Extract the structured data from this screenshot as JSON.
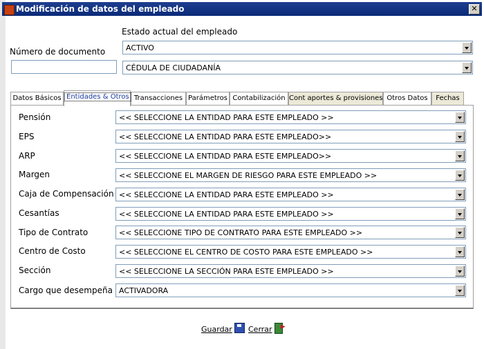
{
  "window": {
    "title": "Modificación de datos del empleado",
    "close_glyph": "✕"
  },
  "header": {
    "estado_label": "Estado actual del empleado",
    "estado_value": "ACTIVO",
    "documento_label": "Número de documento",
    "documento_value": "",
    "tipo_documento_value": "CÉDULA DE CIUDADANÍA"
  },
  "tabs": [
    {
      "label": "Datos Básicos"
    },
    {
      "label": "Entidades & Otros"
    },
    {
      "label": "Transacciones"
    },
    {
      "label": "Parámetros"
    },
    {
      "label": "Contabilización"
    },
    {
      "label": "Cont aportes & provisiones"
    },
    {
      "label": "Otros Datos"
    },
    {
      "label": "Fechas"
    }
  ],
  "active_tab": "Entidades & Otros",
  "fields": [
    {
      "label": "Pensión",
      "value": "<< SELECCIONE LA ENTIDAD PARA ESTE EMPLEADO >>"
    },
    {
      "label": "EPS",
      "value": "<< SELECCIONE LA ENTIDAD PARA ESTE EMPLEADO>>"
    },
    {
      "label": "ARP",
      "value": "<< SELECCIONE LA ENTIDAD PARA ESTE EMPLEADO>>"
    },
    {
      "label": "Margen",
      "value": "<< SELECCIONE EL MARGEN DE RIESGO PARA ESTE EMPLEADO >>"
    },
    {
      "label": "Caja de Compensación",
      "value": "<< SELECCIONE LA ENTIDAD PARA ESTE EMPLEADO >>"
    },
    {
      "label": "Cesantías",
      "value": "<< SELECCIONE LA ENTIDAD PARA ESTE EMPLEADO >>"
    },
    {
      "label": "Tipo de Contrato",
      "value": "<< SELECCIONE TIPO DE CONTRATO PARA ESTE EMPLEADO >>"
    },
    {
      "label": "Centro de Costo",
      "value": "<< SELECCIONE EL CENTRO DE COSTO PARA ESTE EMPLEADO >>"
    },
    {
      "label": "Sección",
      "value": "<< SELECCIONE LA SECCIÓN PARA ESTE EMPLEADO >>"
    },
    {
      "label": "Cargo que desempeña",
      "value": "ACTIVADORA"
    }
  ],
  "buttons": {
    "guardar_label": "Guardar",
    "cerrar_label": "Cerrar"
  },
  "icons": {
    "app": "app-icon",
    "save": "floppy-disk-icon",
    "exit": "exit-door-icon"
  },
  "colors": {
    "titlebar": "#0a2a78",
    "panel_bg": "#ffffff",
    "tab_dark": "#ece9d8"
  }
}
